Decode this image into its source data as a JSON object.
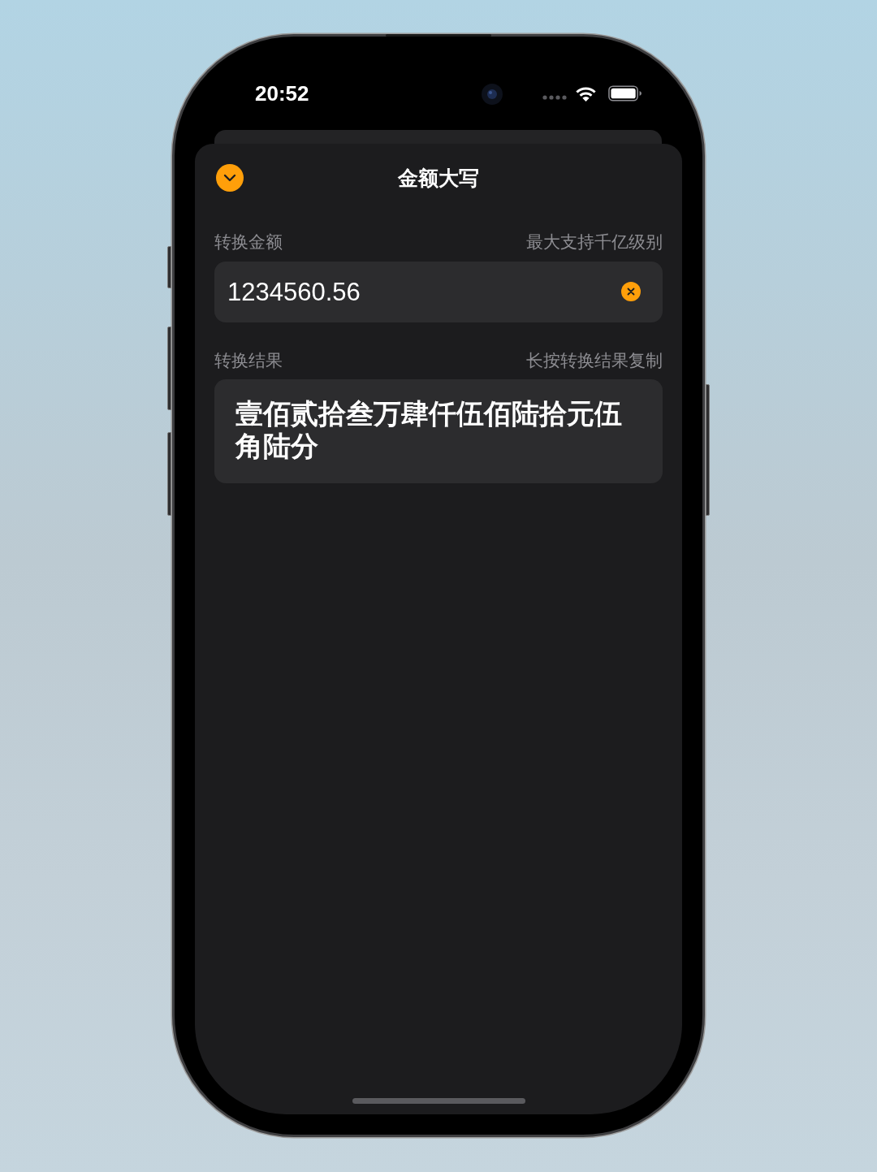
{
  "status_bar": {
    "time": "20:52"
  },
  "sheet": {
    "title": "金额大写"
  },
  "amount": {
    "label": "转换金额",
    "hint": "最大支持千亿级别",
    "value": "1234560.56"
  },
  "result": {
    "label": "转换结果",
    "hint": "长按转换结果复制",
    "text": "壹佰贰拾叁万肆仟伍佰陆拾元伍角陆分"
  }
}
